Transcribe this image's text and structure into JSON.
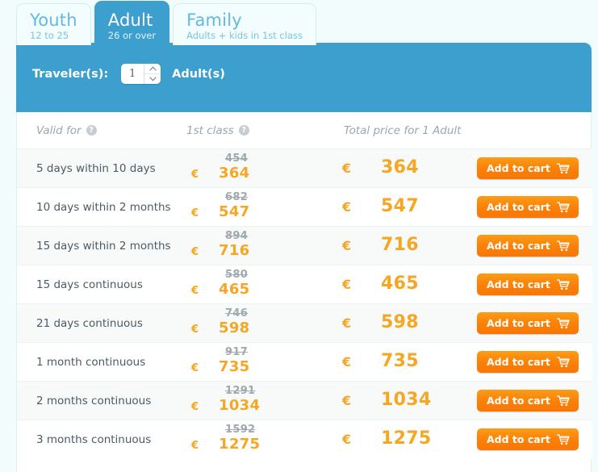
{
  "tabs": [
    {
      "title": "Youth",
      "subtitle": "12 to 25",
      "active": false,
      "name": "tab-youth"
    },
    {
      "title": "Adult",
      "subtitle": "26 or over",
      "active": true,
      "name": "tab-adult"
    },
    {
      "title": "Family",
      "subtitle": "Adults + kids in 1st class",
      "active": false,
      "name": "tab-family"
    }
  ],
  "traveler_bar": {
    "label": "Traveler(s):",
    "count_value": "1",
    "unit_label": "Adult(s)",
    "increment_icon": "chevron-up-icon",
    "decrement_icon": "chevron-down-icon"
  },
  "table": {
    "headers": {
      "valid_for": "Valid for",
      "first_class": "1st class",
      "total_price": "Total price for 1 Adult",
      "help_glyph": "?"
    },
    "currency_symbol": "€",
    "rows": [
      {
        "valid_for": "5 days within 10 days",
        "old_price": "454",
        "new_price": "364",
        "total_price": "364",
        "cart_label": "Add to cart"
      },
      {
        "valid_for": "10 days within 2 months",
        "old_price": "682",
        "new_price": "547",
        "total_price": "547",
        "cart_label": "Add to cart"
      },
      {
        "valid_for": "15 days within 2 months",
        "old_price": "894",
        "new_price": "716",
        "total_price": "716",
        "cart_label": "Add to cart"
      },
      {
        "valid_for": "15 days continuous",
        "old_price": "580",
        "new_price": "465",
        "total_price": "465",
        "cart_label": "Add to cart"
      },
      {
        "valid_for": "21 days continuous",
        "old_price": "746",
        "new_price": "598",
        "total_price": "598",
        "cart_label": "Add to cart"
      },
      {
        "valid_for": "1 month continuous",
        "old_price": "917",
        "new_price": "735",
        "total_price": "735",
        "cart_label": "Add to cart"
      },
      {
        "valid_for": "2 months continuous",
        "old_price": "1291",
        "new_price": "1034",
        "total_price": "1034",
        "cart_label": "Add to cart"
      },
      {
        "valid_for": "3 months continuous",
        "old_price": "1592",
        "new_price": "1275",
        "total_price": "1275",
        "cart_label": "Add to cart"
      }
    ]
  },
  "colors": {
    "brand_blue": "#3d9fcd",
    "tab_inactive_text": "#63b9dd",
    "accent_orange": "#f5a623",
    "cart_orange": "#fb8008",
    "page_background": "#f2fcfd",
    "row_alt_background": "#f7faf9",
    "old_price_gray": "#9fa9af"
  }
}
